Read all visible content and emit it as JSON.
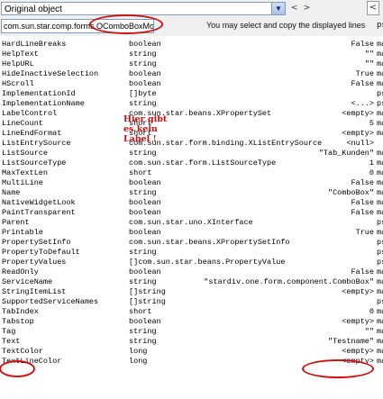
{
  "object_selector": {
    "value": "Original object",
    "dropdown_icon": "chevron-down-icon"
  },
  "nav": {
    "left": "<",
    "right": ">",
    "back_button": "<"
  },
  "path_field": "com.sun.star.comp.forms.OComboBoxModel",
  "hint": "You may select and copy the displayed lines",
  "ps_label": "ps",
  "annotation_color": "#cc1010",
  "annotation_text": [
    "Hier gibt",
    "es kein",
    "Label !"
  ],
  "properties": [
    {
      "name": "HardLineBreaks",
      "type": "boolean",
      "value": "False",
      "flag": "ma"
    },
    {
      "name": "HelpText",
      "type": "string",
      "value": "\"\"",
      "flag": "ma"
    },
    {
      "name": "HelpURL",
      "type": "string",
      "value": "\"\"",
      "flag": "ma"
    },
    {
      "name": "HideInactiveSelection",
      "type": "boolean",
      "value": "True",
      "flag": "ma"
    },
    {
      "name": "HScroll",
      "type": "boolean",
      "value": "False",
      "flag": "ma"
    },
    {
      "name": "ImplementationId",
      "type": "[]byte",
      "value": "",
      "flag": "ps"
    },
    {
      "name": "ImplementationName",
      "type": "string",
      "value": "<...>",
      "flag": "ps"
    },
    {
      "name": "LabelControl",
      "type": "com.sun.star.beans.XPropertySet",
      "value": "<empty>",
      "flag": "ma"
    },
    {
      "name": "LineCount",
      "type": "short",
      "value": "5",
      "flag": "ma"
    },
    {
      "name": "LineEndFormat",
      "type": "short",
      "value": "<empty>",
      "flag": "ma"
    },
    {
      "name": "ListEntrySource",
      "type": "com.sun.star.form.binding.XListEntrySource",
      "value": "<null>",
      "flag": ""
    },
    {
      "name": "ListSource",
      "type": "string",
      "value": "\"Tab_Kunden\"",
      "flag": "ma"
    },
    {
      "name": "ListSourceType",
      "type": "com.sun.star.form.ListSourceType",
      "value": "1",
      "flag": "ma"
    },
    {
      "name": "MaxTextLen",
      "type": "short",
      "value": "0",
      "flag": "ma"
    },
    {
      "name": "MultiLine",
      "type": "boolean",
      "value": "False",
      "flag": "ma"
    },
    {
      "name": "Name",
      "type": "string",
      "value": "\"ComboBox\"",
      "flag": "ma"
    },
    {
      "name": "NativeWidgetLook",
      "type": "boolean",
      "value": "False",
      "flag": "ma"
    },
    {
      "name": "PaintTransparent",
      "type": "boolean",
      "value": "False",
      "flag": "ma"
    },
    {
      "name": "Parent",
      "type": "com.sun.star.uno.XInterface",
      "value": "",
      "flag": "ps"
    },
    {
      "name": "Printable",
      "type": "boolean",
      "value": "True",
      "flag": "ma"
    },
    {
      "name": "PropertySetInfo",
      "type": "com.sun.star.beans.XPropertySetInfo",
      "value": "",
      "flag": "ps"
    },
    {
      "name": "PropertyToDefault",
      "type": "string",
      "value": "",
      "flag": "ps"
    },
    {
      "name": "PropertyValues",
      "type": "[]com.sun.star.beans.PropertyValue",
      "value": "",
      "flag": "ps"
    },
    {
      "name": "ReadOnly",
      "type": "boolean",
      "value": "False",
      "flag": "ma"
    },
    {
      "name": "ServiceName",
      "type": "string",
      "value": "\"stardiv.one.form.component.ComboBox\"",
      "flag": "ma"
    },
    {
      "name": "StringItemList",
      "type": "[]string",
      "value": "<empty>",
      "flag": "ma"
    },
    {
      "name": "SupportedServiceNames",
      "type": "[]string",
      "value": "",
      "flag": "ps"
    },
    {
      "name": "TabIndex",
      "type": "short",
      "value": "0",
      "flag": "ma"
    },
    {
      "name": "Tabstop",
      "type": "boolean",
      "value": "<empty>",
      "flag": "ma"
    },
    {
      "name": "Tag",
      "type": "string",
      "value": "\"\"",
      "flag": "ma"
    },
    {
      "name": "Text",
      "type": "string",
      "value": "\"Testname\"",
      "flag": "ma"
    },
    {
      "name": "TextColor",
      "type": "long",
      "value": "<empty>",
      "flag": "ma"
    },
    {
      "name": "TextLineColor",
      "type": "long",
      "value": "<empty>",
      "flag": "ma"
    }
  ]
}
